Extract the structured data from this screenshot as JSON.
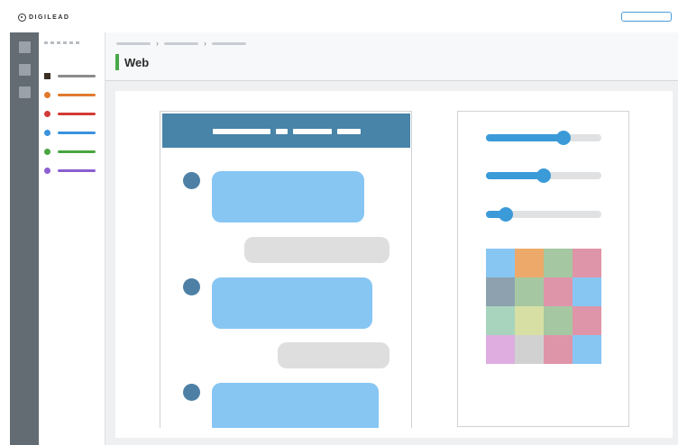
{
  "brand": {
    "name": "DIGILEAD",
    "logo_icon": "gear-circle-icon"
  },
  "header": {
    "title": "Web",
    "accent_color": "#49a84a"
  },
  "nav": {
    "items": [
      {
        "icon": "square-icon",
        "color": "#3a3024",
        "line_color": "#8b8b8b"
      },
      {
        "icon": "dot-icon",
        "color": "#e17a2e",
        "line_color": "#e17a2e"
      },
      {
        "icon": "dot-icon",
        "color": "#d23a35",
        "line_color": "#d23a35"
      },
      {
        "icon": "dot-icon",
        "color": "#3a93dd",
        "line_color": "#3a93dd"
      },
      {
        "icon": "dot-icon",
        "color": "#4ba641",
        "line_color": "#4ba641"
      },
      {
        "icon": "dot-icon",
        "color": "#8c5fd0",
        "line_color": "#8c5fd0"
      }
    ]
  },
  "sliders": [
    0.67,
    0.5,
    0.17
  ],
  "palette": [
    "#87c6f3",
    "#eca96a",
    "#a5c8a2",
    "#df95a9",
    "#8da1af",
    "#a5c8a2",
    "#df95a9",
    "#87c6f3",
    "#a8d4bd",
    "#d7dfa4",
    "#a5c8a2",
    "#df95a9",
    "#dfade0",
    "#d1d1d1",
    "#df95a9",
    "#87c6f3"
  ],
  "colors": {
    "rail": "#636b73",
    "phone_bar": "#4883a8",
    "bubble_in": "#87c6f3",
    "bubble_out": "#dedede",
    "avatar": "#4e80a6",
    "slider": "#3b9ad8"
  }
}
